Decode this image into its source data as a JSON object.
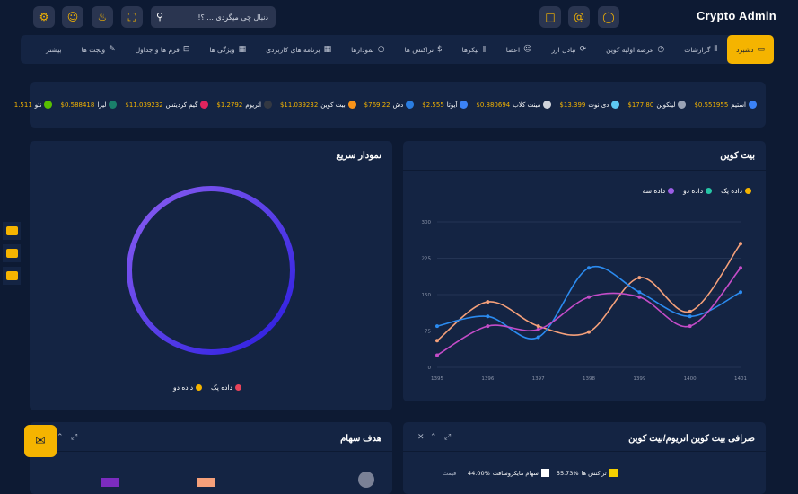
{
  "app": {
    "title": "Crypto Admin"
  },
  "search": {
    "placeholder": "دنبال چی میگردی ... ؟!"
  },
  "nav": [
    {
      "label": "دشبرد",
      "icon": "monitor-icon",
      "active": true
    },
    {
      "label": "گزارشات",
      "icon": "bar-chart-icon"
    },
    {
      "label": "عرضه اولیه کوین",
      "icon": "clock-icon"
    },
    {
      "label": "تبادل ارز",
      "icon": "exchange-icon"
    },
    {
      "label": "اعضا",
      "icon": "users-icon"
    },
    {
      "label": "تیکرها",
      "icon": "sliders-icon"
    },
    {
      "label": "تراکنش ها",
      "icon": "dollar-icon"
    },
    {
      "label": "نمودارها",
      "icon": "clock-icon"
    },
    {
      "label": "برنامه های کاربردی",
      "icon": "grid-icon"
    },
    {
      "label": "ویژگی ها",
      "icon": "grid-icon"
    },
    {
      "label": "فرم ها و جداول",
      "icon": "inbox-icon"
    },
    {
      "label": "ویجت ها",
      "icon": "edit-icon"
    },
    {
      "label": "بیشتر",
      "icon": ""
    }
  ],
  "ticker": [
    {
      "name": "استیم",
      "value": "$0.551955",
      "color": "#3b82f6"
    },
    {
      "name": "لیتکوین",
      "value": "$177.80",
      "color": "#9aa3b5"
    },
    {
      "name": "دی نوت",
      "value": "$13.399",
      "color": "#5ec8f2"
    },
    {
      "name": "مینت کلاب",
      "value": "$0.880694",
      "color": "#d0d4dc"
    },
    {
      "name": "آیوتا",
      "value": "$2.555",
      "color": "#3b82f6"
    },
    {
      "name": "دش",
      "value": "$769.22",
      "color": "#2a7de1"
    },
    {
      "name": "بیت کوین",
      "value": "$11.039232",
      "color": "#f7931a"
    },
    {
      "name": "اتریوم",
      "value": "$1.2792",
      "color": "#333842"
    },
    {
      "name": "گیم کردیتس",
      "value": "$11.039232",
      "color": "#e0245e"
    },
    {
      "name": "لیرا",
      "value": "$0.588418",
      "color": "#1a7f6a"
    },
    {
      "name": "نئو",
      "value": "1.511",
      "color": "#58bf00"
    }
  ],
  "card_btc": {
    "title": "بیت کوین"
  },
  "card_quick": {
    "title": "نمودار سریع"
  },
  "card_goal": {
    "title": "هدف سهام"
  },
  "card_exchange": {
    "title": "صرافی بیت کوین اتریوم/بیت کوین"
  },
  "chart_data": [
    {
      "type": "line",
      "title": "بیت کوین",
      "x": [
        "1395",
        "1396",
        "1397",
        "1398",
        "1399",
        "1400",
        "1401"
      ],
      "ylim": [
        0,
        300
      ],
      "yticks": [
        0,
        75,
        150,
        225,
        300
      ],
      "series": [
        {
          "name": "داده یک",
          "color": "#f5a07a",
          "values": [
            55,
            135,
            85,
            73,
            185,
            115,
            255
          ]
        },
        {
          "name": "داده دو",
          "color": "#2b8bf0",
          "values": [
            85,
            105,
            62,
            205,
            155,
            105,
            155
          ]
        },
        {
          "name": "داده سه",
          "color": "#c44cc8",
          "values": [
            25,
            85,
            78,
            145,
            145,
            85,
            205
          ]
        }
      ]
    },
    {
      "type": "pie",
      "title": "نمودار سریع",
      "series": [
        {
          "name": "داده یک",
          "color": "#e8445a",
          "value": 0
        },
        {
          "name": "داده دو",
          "color": "#f5b400",
          "value": 100
        }
      ]
    }
  ],
  "legend_btc": [
    {
      "label": "داده یک",
      "color": "#f5b400"
    },
    {
      "label": "داده دو",
      "color": "#26c6a6"
    },
    {
      "label": "داده سه",
      "color": "#9b5de5"
    }
  ],
  "legend_quick": [
    {
      "label": "داده یک",
      "color": "#e8445a"
    },
    {
      "label": "داده دو",
      "color": "#f5b400"
    }
  ],
  "exchange_legend": [
    {
      "label": "تراکنش ها",
      "pct": "55.73%",
      "color": "#f5d000"
    },
    {
      "label": "سهام مایکروسافت",
      "pct": "44.00%",
      "color": "#ffffff"
    }
  ],
  "exchange_label": "قیمت"
}
